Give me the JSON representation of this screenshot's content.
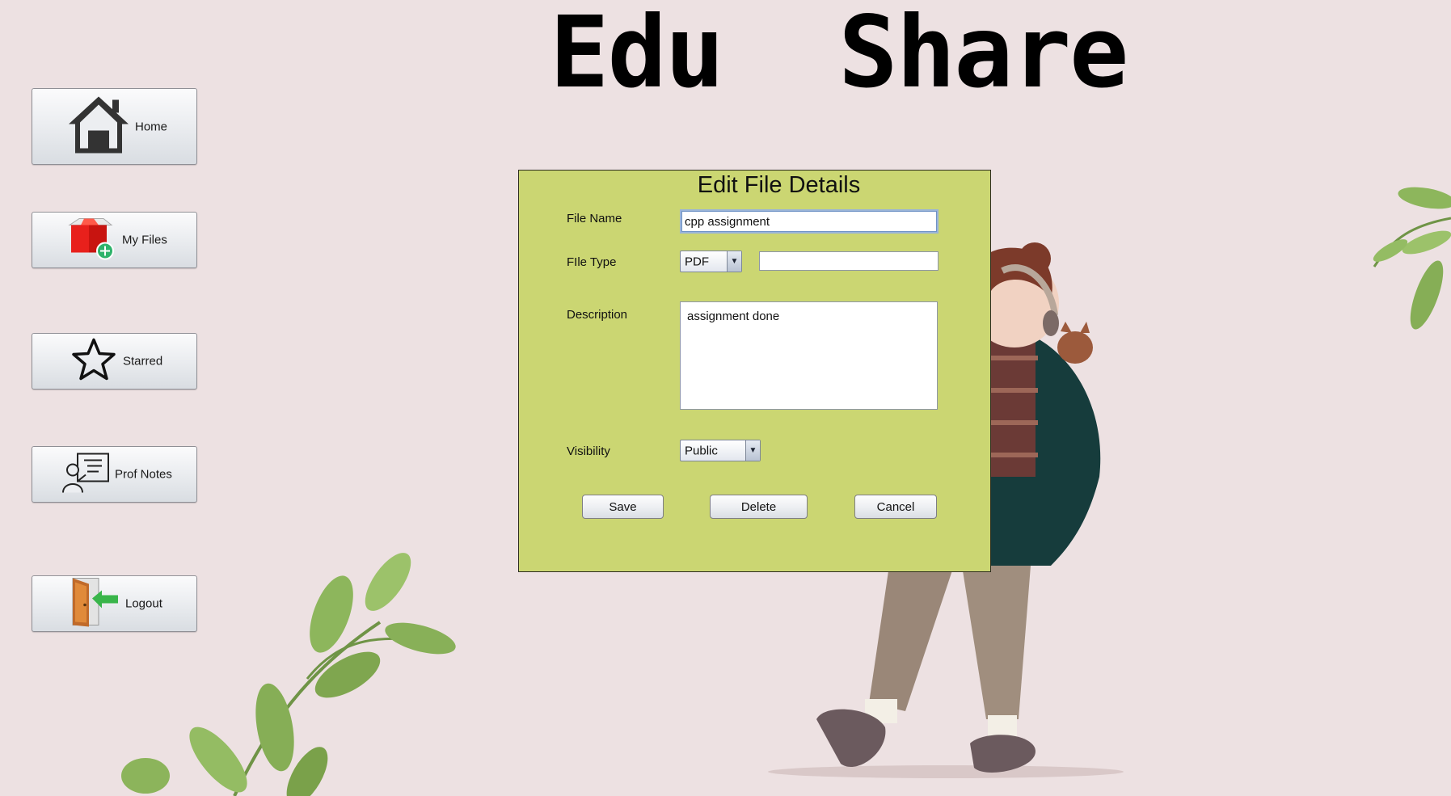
{
  "app": {
    "title": "Edu  Share"
  },
  "sidebar": {
    "items": [
      {
        "label": "Home",
        "icon": "home-icon"
      },
      {
        "label": "My Files",
        "icon": "my-files-icon"
      },
      {
        "label": "Starred",
        "icon": "star-icon"
      },
      {
        "label": "Prof Notes",
        "icon": "prof-notes-icon"
      },
      {
        "label": "Logout",
        "icon": "logout-door-icon"
      }
    ]
  },
  "dialog": {
    "title": "Edit File Details",
    "file_name_label": "File Name",
    "file_name_value": "cpp assignment",
    "file_type_label": "FIle Type",
    "file_type_value": "PDF",
    "file_type_extra_value": "",
    "description_label": "Description",
    "description_value": "assignment done",
    "visibility_label": "Visibility",
    "visibility_value": "Public",
    "save_label": "Save",
    "delete_label": "Delete",
    "cancel_label": "Cancel"
  },
  "colors": {
    "background": "#ede1e2",
    "dialog_background": "#cbd672",
    "leaf_green": "#7faa4e"
  }
}
